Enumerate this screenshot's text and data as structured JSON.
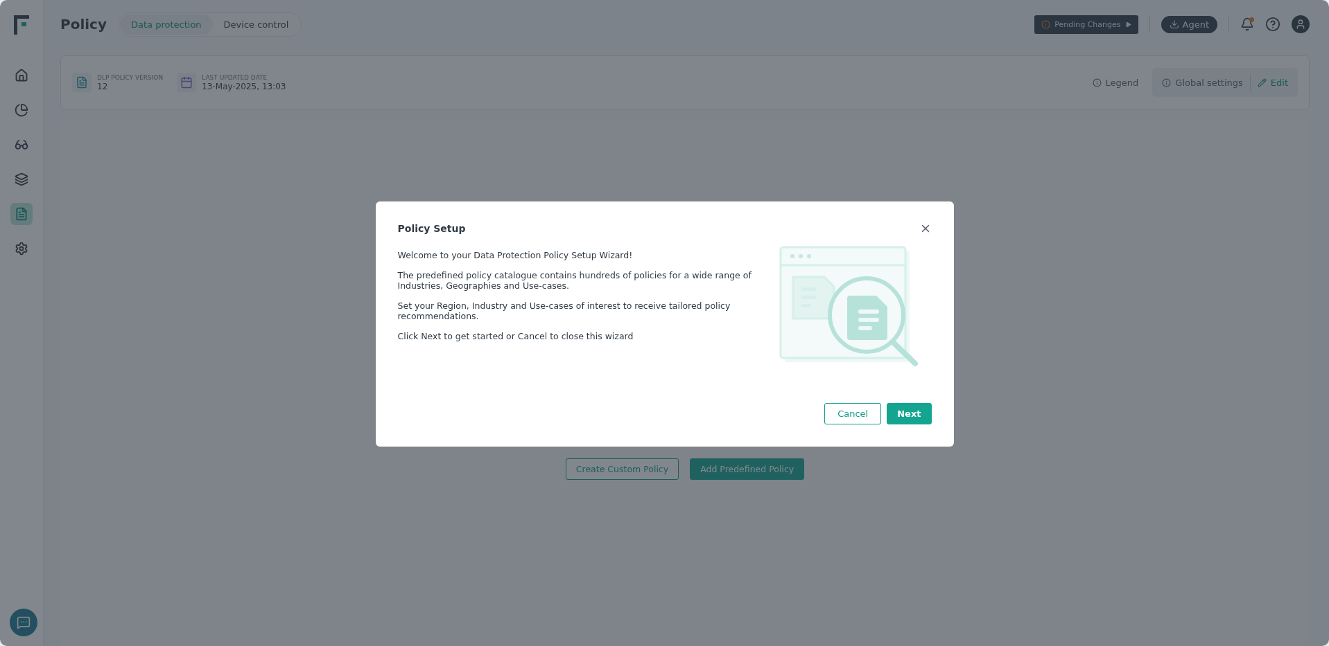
{
  "sidebar": {
    "items": [
      {
        "selected": false
      },
      {
        "selected": false
      },
      {
        "selected": false
      },
      {
        "selected": false
      },
      {
        "selected": true
      },
      {
        "selected": false
      }
    ]
  },
  "header": {
    "title": "Policy",
    "tabs": [
      {
        "label": "Data protection",
        "selected": true
      },
      {
        "label": "Device control",
        "selected": false
      }
    ],
    "pending_changes": "Pending Changes",
    "agent": "Agent",
    "notifications_unread": true
  },
  "info": {
    "version_label": "DLP POLICY VERSION",
    "version": "12",
    "date_label": "LAST UPDATED DATE",
    "date": "13-May-2025, 13:03",
    "legend": "Legend",
    "global_settings": "Global settings",
    "edit": "Edit"
  },
  "actions": [
    "Create Custom Policy",
    "Add Predefined Policy"
  ],
  "dialog": {
    "title": "Policy Setup",
    "paragraphs": [
      "Welcome to your Data Protection Policy Setup Wizard!",
      "The predefined policy catalogue contains hundreds of policies for a wide range of Industries, Geographies and Use-cases.",
      "Set your Region, Industry and Use-cases of interest to receive tailored policy recommendations.",
      "Click Next to get started or Cancel to close this wizard"
    ],
    "cancel": "Cancel",
    "next": "Next"
  }
}
